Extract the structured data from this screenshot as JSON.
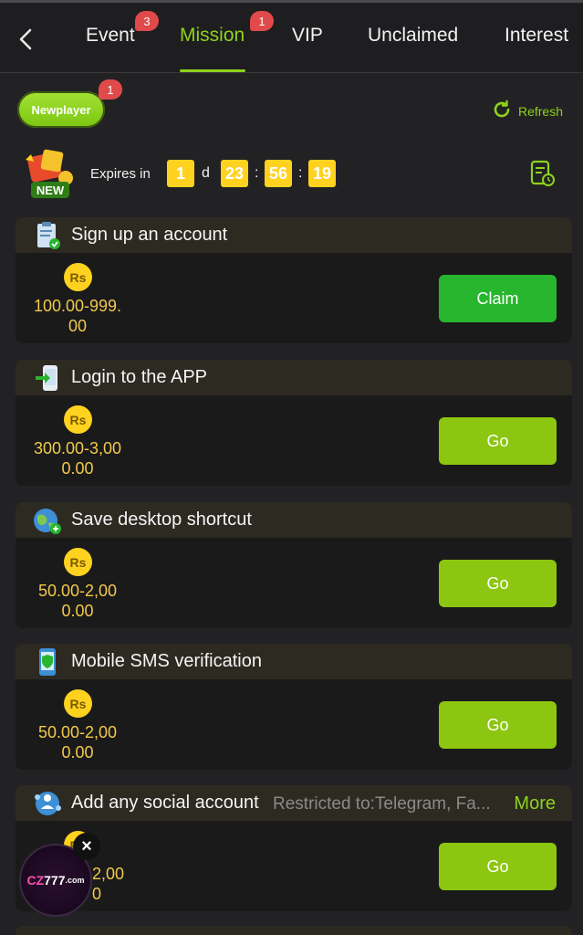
{
  "tabs": [
    {
      "label": "Event",
      "badge": "3"
    },
    {
      "label": "Mission",
      "badge": "1",
      "active": true
    },
    {
      "label": "VIP"
    },
    {
      "label": "Unclaimed"
    },
    {
      "label": "Interest"
    }
  ],
  "newplayer": {
    "label": "Newplayer",
    "badge": "1"
  },
  "refresh_label": "Refresh",
  "new_badge_text": "NEW",
  "expires": {
    "label": "Expires in",
    "days": "1",
    "day_unit": "d",
    "hours": "23",
    "minutes": "56",
    "seconds": "19",
    "sep": ":"
  },
  "currency_label": "Rs",
  "missions": [
    {
      "title": "Sign up an account",
      "amount_line1": "100.00-999.",
      "amount_line2": "00",
      "button": "Claim",
      "icon": "clipboard-check-icon"
    },
    {
      "title": "Login to the APP",
      "amount_line1": "300.00-3,00",
      "amount_line2": "0.00",
      "button": "Go",
      "icon": "phone-login-icon"
    },
    {
      "title": "Save desktop shortcut",
      "amount_line1": "50.00-2,00",
      "amount_line2": "0.00",
      "button": "Go",
      "icon": "globe-shortcut-icon"
    },
    {
      "title": "Mobile SMS verification",
      "amount_line1": "50.00-2,00",
      "amount_line2": "0.00",
      "button": "Go",
      "icon": "phone-shield-icon"
    },
    {
      "title": "Add any social account",
      "note": "Restricted to:Telegram, Fa...",
      "more": "More",
      "amount_line1": "2,00",
      "amount_line2": "0",
      "button": "Go",
      "icon": "social-network-icon"
    }
  ],
  "float_logo": {
    "text_a": "CZ",
    "text_b": "777",
    "text_c": ".com"
  },
  "float_close": "×",
  "colors": {
    "accent": "#8fd11b",
    "claim": "#27b62e",
    "go": "#8cc610",
    "gold": "#ffd21f",
    "badge": "#e04a4a"
  }
}
